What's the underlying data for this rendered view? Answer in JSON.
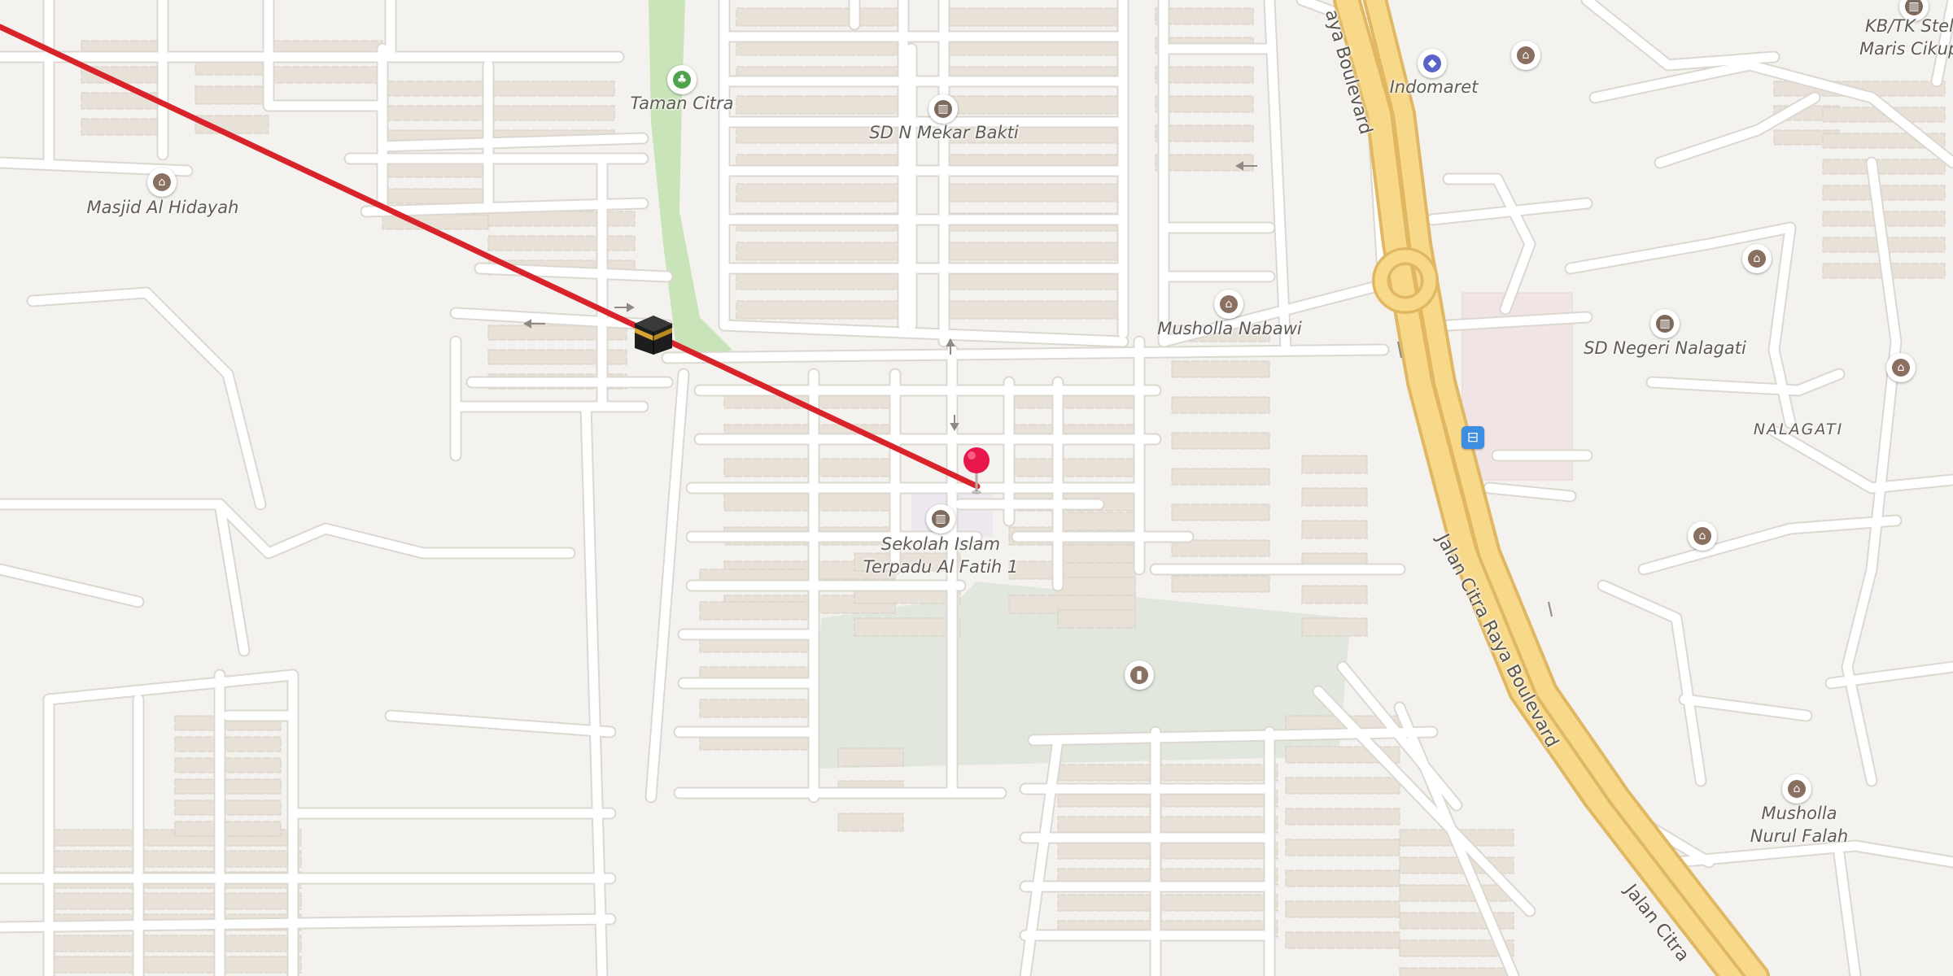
{
  "map": {
    "colors": {
      "background": "#f4f2ee",
      "road": "#ffffff",
      "road_casing": "#dcd8d1",
      "building": "#e8e1d8",
      "building_edge": "#d9cfc3",
      "park": "#c9e4b8",
      "cemetery": "#e1e7dd",
      "highway": "#f8d98a",
      "highway_casing": "#e0b864",
      "qibla_line": "#d8232a",
      "pin": "#e8174b",
      "school_area": "#e9e2f0"
    },
    "places": {
      "taman_citra": "Taman Citra",
      "sd_mekar_bakti": "SD N Mekar Bakti",
      "masjid_al_hidayah": "Masjid Al Hidayah",
      "musholla_nabawi": "Musholla Nabawi",
      "indomaret": "Indomaret",
      "kb_tk_line1": "KB/TK Stell",
      "kb_tk_line2": "Maris Cikup",
      "sd_negeri_nalagati": "SD Negeri Nalagati",
      "nalagati": "NALAGATI",
      "sekolah_line1": "Sekolah Islam",
      "sekolah_line2": "Terpadu Al Fatih 1",
      "musholla_nurul_line1": "Musholla",
      "musholla_nurul_line2": "Nurul Falah"
    },
    "roads": {
      "raya_boulevard_top": "aya Boulevard",
      "citra_raya_boulevard": "Jalan Citra Raya Boulevard",
      "jalan_citra_bottom": "Jalan Citra"
    },
    "icons": {
      "park": "tree-icon",
      "school": "school-icon",
      "mosque": "mosque-icon",
      "shop": "shopping-bag-icon",
      "bus": "bus-stop-icon",
      "cemetery": "cemetery-icon",
      "kaaba": "kaaba-icon",
      "pin": "location-pin-icon"
    }
  }
}
